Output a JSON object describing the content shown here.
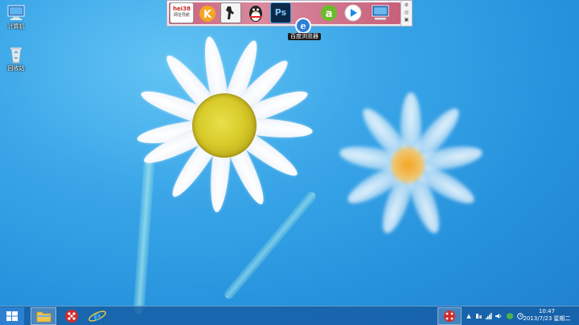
{
  "desktop": {
    "icons": [
      {
        "label": "计算机"
      },
      {
        "label": "回收站"
      }
    ]
  },
  "dock": {
    "apps": [
      {
        "name": "hei38 网址导航",
        "label": "hei38",
        "sublabel": "网址导航"
      },
      {
        "name": "kugou"
      },
      {
        "name": "counter-strike"
      },
      {
        "name": "qq"
      },
      {
        "name": "photoshop",
        "label": "Ps"
      },
      {
        "name": "baidu-browser"
      },
      {
        "name": "aiqiyi"
      },
      {
        "name": "media-player"
      },
      {
        "name": "computer"
      }
    ],
    "tooltip": "百度浏览器"
  },
  "taskbar": {
    "clock_time": "10:47",
    "clock_date": "2013/7/23 星期二",
    "tray_arrow": "▲"
  },
  "colors": {
    "sky": "#2b95de",
    "taskbar": "#1a5a9e",
    "dock_accent": "#c8607a"
  }
}
